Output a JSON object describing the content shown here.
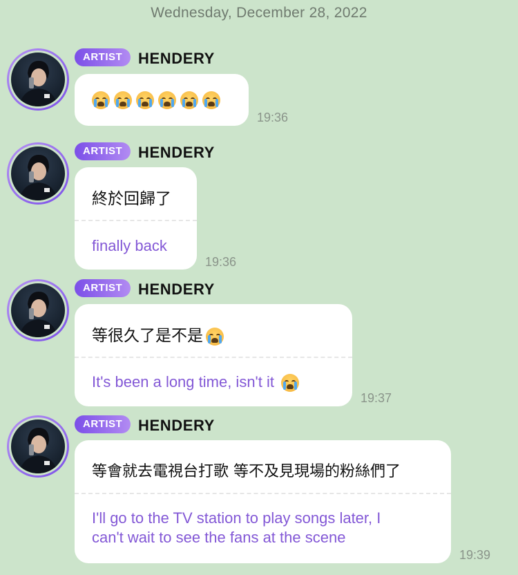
{
  "chat": {
    "date_header": "Wednesday, December 28, 2022",
    "messages": [
      {
        "badge": "ARTIST",
        "sender": "HENDERY",
        "original": "😭😭😭😭😭😭",
        "emoji_count": 6,
        "translation": "",
        "time": "19:36"
      },
      {
        "badge": "ARTIST",
        "sender": "HENDERY",
        "original": "終於回歸了",
        "translation": "finally back",
        "time": "19:36"
      },
      {
        "badge": "ARTIST",
        "sender": "HENDERY",
        "original": "等很久了是不是",
        "original_emoji": "😭",
        "translation": "It's been a long time, isn't it",
        "translation_emoji": "😭",
        "time": "19:37"
      },
      {
        "badge": "ARTIST",
        "sender": "HENDERY",
        "original": "等會就去電視台打歌 等不及見現場的粉絲們了",
        "translation_line1": "I'll go to the TV station to play songs later, I",
        "translation_line2": "can't wait to see the fans at the scene",
        "time": "19:39"
      }
    ]
  },
  "colors": {
    "background": "#cce4cb",
    "bubble": "#ffffff",
    "badge_gradient_start": "#7b4fe8",
    "badge_gradient_end": "#b28bf2",
    "translation_text": "#8358d6",
    "timestamp": "#8a948a"
  },
  "icons": {
    "avatar": "artist-avatar-photo",
    "emoji": "loudly-crying-face-emoji"
  }
}
